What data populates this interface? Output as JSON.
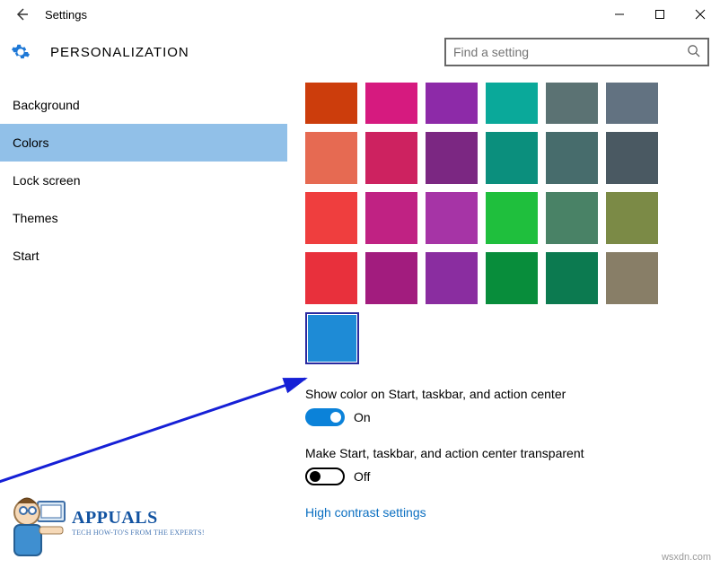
{
  "titlebar": {
    "title": "Settings"
  },
  "header": {
    "page_title": "PERSONALIZATION"
  },
  "search": {
    "placeholder": "Find a setting"
  },
  "sidebar": {
    "items": [
      {
        "label": "Background"
      },
      {
        "label": "Colors"
      },
      {
        "label": "Lock screen"
      },
      {
        "label": "Themes"
      },
      {
        "label": "Start"
      }
    ],
    "selected_index": 1
  },
  "colors": {
    "rows": [
      [
        "#cc3d0c",
        "#d61a7f",
        "#8d2aa8",
        "#0aa99a",
        "#5b7273",
        "#627281"
      ],
      [
        "#e66a52",
        "#cd2260",
        "#7b2782",
        "#0b8f7d",
        "#476c6c",
        "#4a5962"
      ],
      [
        "#ef3e3e",
        "#c02283",
        "#a634a6",
        "#1fbf3d",
        "#498266",
        "#7b8a46"
      ],
      [
        "#e8303c",
        "#a21c7e",
        "#8a2da0",
        "#088d3b",
        "#0c7a50",
        "#887e67"
      ]
    ],
    "selected_color": "#1e8bd6"
  },
  "settings": {
    "show_color": {
      "label": "Show color on Start, taskbar, and action center",
      "state": "On",
      "on": true
    },
    "transparency": {
      "label": "Make Start, taskbar, and action center transparent",
      "state": "Off",
      "on": false
    },
    "high_contrast_link": "High contrast settings"
  },
  "watermark": "wsxdn.com",
  "appuals": {
    "brand": "APPUALS",
    "tagline": "TECH HOW-TO'S FROM THE EXPERTS!"
  }
}
